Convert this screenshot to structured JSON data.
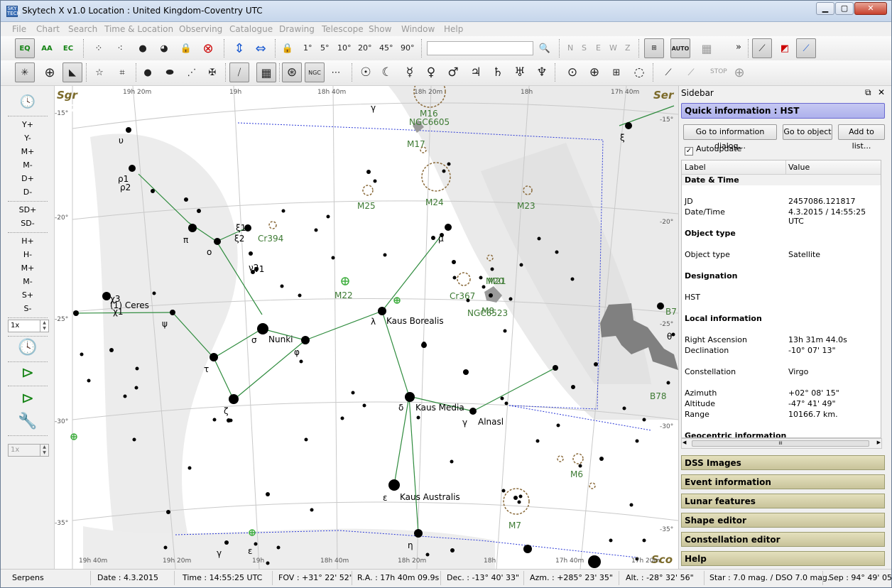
{
  "window": {
    "title": "Skytech X v1.0   Location : United Kingdom-Coventry  UTC",
    "app_icon_text": "SKY TECH"
  },
  "menu": [
    "File",
    "Chart",
    "Search",
    "Time & Location",
    "Observing",
    "Catalogue",
    "Drawing",
    "Telescope",
    "Show",
    "Window",
    "Help"
  ],
  "toolbar1": {
    "eq": "EQ",
    "aa": "AA",
    "ec": "EC",
    "fov": [
      "1°",
      "5°",
      "10°",
      "20°",
      "45°",
      "90°"
    ],
    "search_value": "",
    "directions": [
      "N",
      "S",
      "E",
      "W",
      "Z"
    ],
    "auto": "AUTO",
    "more": "»"
  },
  "toolbar2": {
    "ngc": "NGC",
    "stop": "STOP",
    "planets": [
      "☉",
      "☾",
      "☿",
      "♀",
      "♂",
      "♃",
      "♄",
      "♅",
      "♆"
    ]
  },
  "leftbar": {
    "buttons": [
      "Y+",
      "Y-",
      "M+",
      "M-",
      "D+",
      "D-",
      "SD+",
      "SD-",
      "H+",
      "H-",
      "M+",
      "M-",
      "S+",
      "S-"
    ],
    "spin1": "1x",
    "spin2": "1x",
    "now": "NOW"
  },
  "chart": {
    "fps": "2ms 416 fps",
    "ra_top": [
      "19h 20m",
      "19h",
      "18h 40m",
      "18h 20m",
      "18h",
      "17h 40m"
    ],
    "ra_bottom": [
      "19h 40m",
      "19h 20m",
      "19h",
      "18h 40m",
      "18h 20m",
      "18h",
      "17h 40m",
      "17h 20m"
    ],
    "dec_left": [
      "-15°",
      "-20°",
      "-25°",
      "-30°",
      "-35°"
    ],
    "dec_right": [
      "-15°",
      "-20°",
      "-25°",
      "-30°",
      "-35°"
    ],
    "constellations": [
      "Sgr",
      "Ser",
      "Sco"
    ],
    "star_names": [
      "Nunki",
      "Kaus Borealis",
      "Kaus Media",
      "Alnasl",
      "Kaus Australis",
      "(1) Ceres"
    ],
    "greek": [
      "υ",
      "ρ1",
      "ρ2",
      "π",
      "ο",
      "ξ1",
      "ξ2",
      "ν2",
      "ν1",
      "χ3",
      "χ1",
      "ψ",
      "σ",
      "τ",
      "φ",
      "λ",
      "ζ",
      "δ",
      "γ",
      "ε",
      "η",
      "μ",
      "γ",
      "ε",
      "ξ",
      "θ",
      "γ"
    ],
    "dso": [
      "M16",
      "NGC6605",
      "M17",
      "M25",
      "M24",
      "M23",
      "Cr394",
      "M22",
      "Cr367",
      "M20",
      "M21",
      "M8",
      "NGC6523",
      "M6",
      "M7",
      "B7",
      "B78"
    ]
  },
  "sidebar": {
    "title": "Sidebar",
    "quick_info": "Quick information : HST",
    "btn_goto_dialog": "Go to information dialog...",
    "btn_goto_object": "Go to object",
    "btn_add_list": "Add to list...",
    "autoupdate": "Autoupdate",
    "col_label": "Label",
    "col_value": "Value",
    "rows": [
      {
        "label": "Date & Time",
        "value": "",
        "section": true
      },
      {
        "label": "",
        "value": ""
      },
      {
        "label": "JD",
        "value": "2457086.121817"
      },
      {
        "label": "Date/Time",
        "value": "4.3.2015 / 14:55:25 UTC"
      },
      {
        "label": "",
        "value": ""
      },
      {
        "label": "Object type",
        "value": "",
        "section": true
      },
      {
        "label": "",
        "value": ""
      },
      {
        "label": "Object type",
        "value": "Satellite"
      },
      {
        "label": "",
        "value": ""
      },
      {
        "label": "Designation",
        "value": "",
        "section": true
      },
      {
        "label": "",
        "value": ""
      },
      {
        "label": "HST",
        "value": ""
      },
      {
        "label": "",
        "value": ""
      },
      {
        "label": "Local information",
        "value": "",
        "section": true
      },
      {
        "label": "",
        "value": ""
      },
      {
        "label": "Right Ascension",
        "value": "13h 31m 44.0s"
      },
      {
        "label": "Declination",
        "value": "-10° 07' 13\""
      },
      {
        "label": "",
        "value": ""
      },
      {
        "label": "Constellation",
        "value": "Virgo"
      },
      {
        "label": "",
        "value": ""
      },
      {
        "label": "Azimuth",
        "value": "+02° 08' 15\""
      },
      {
        "label": "Altitude",
        "value": "-47° 41' 49\""
      },
      {
        "label": "Range",
        "value": "10166.7 km."
      },
      {
        "label": "",
        "value": ""
      },
      {
        "label": "Geocentric information",
        "value": "",
        "section": true
      }
    ],
    "scroll_grip": "III",
    "panels": [
      "DSS Images",
      "Event information",
      "Lunar features",
      "Shape editor",
      "Constellation editor",
      "Help"
    ]
  },
  "status": {
    "constellation": "Serpens",
    "date": "Date : 4.3.2015",
    "time": "Time : 14:55:25 UTC",
    "fov": "FOV : +31° 22' 52\"",
    "ra": "R.A. : 17h 40m 09.9s",
    "dec": "Dec. : -13° 40' 33\"",
    "azm": "Azm. : +285° 23' 35\"",
    "alt": "Alt. : -28° 32' 56\"",
    "mag": "Star : 7.0 mag. / DSO 7.0 mag.",
    "sep": "Sep : 94° 49' 05\""
  }
}
